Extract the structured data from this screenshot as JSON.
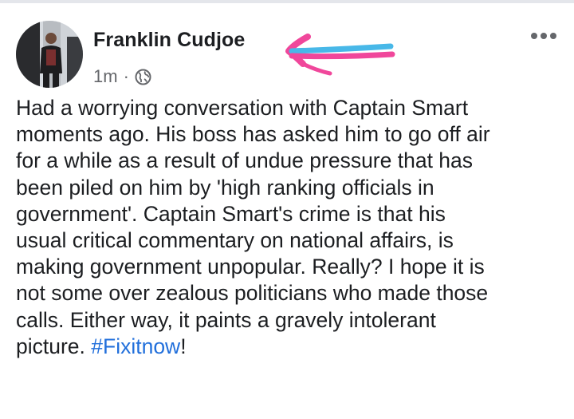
{
  "post": {
    "author_name": "Franklin Cudjoe",
    "timestamp": "1m",
    "separator": "·",
    "privacy_icon": "globe-icon",
    "more_icon": "more-options-icon",
    "annotation": "hand-drawn-arrow",
    "body_lines": [
      "Had a worrying conversation with Captain Smart",
      "moments ago. His boss has asked him to go off air",
      "for a while as a result of undue pressure that has",
      "been piled on him by 'high ranking officials in",
      "government'. Captain Smart's crime is that his",
      "usual critical commentary on national affairs, is",
      "making government unpopular. Really? I hope it is",
      "not some over zealous politicians who made those",
      "calls. Either way, it paints a gravely intolerant"
    ],
    "last_line_prefix": "picture. ",
    "hashtag": "#Fixitnow",
    "last_line_suffix": "!"
  },
  "colors": {
    "text": "#1c1e21",
    "secondary_text": "#65676b",
    "hashtag_blue": "#216fdb",
    "arrow_pink": "#f0479b",
    "arrow_blue": "#48b8e8"
  }
}
